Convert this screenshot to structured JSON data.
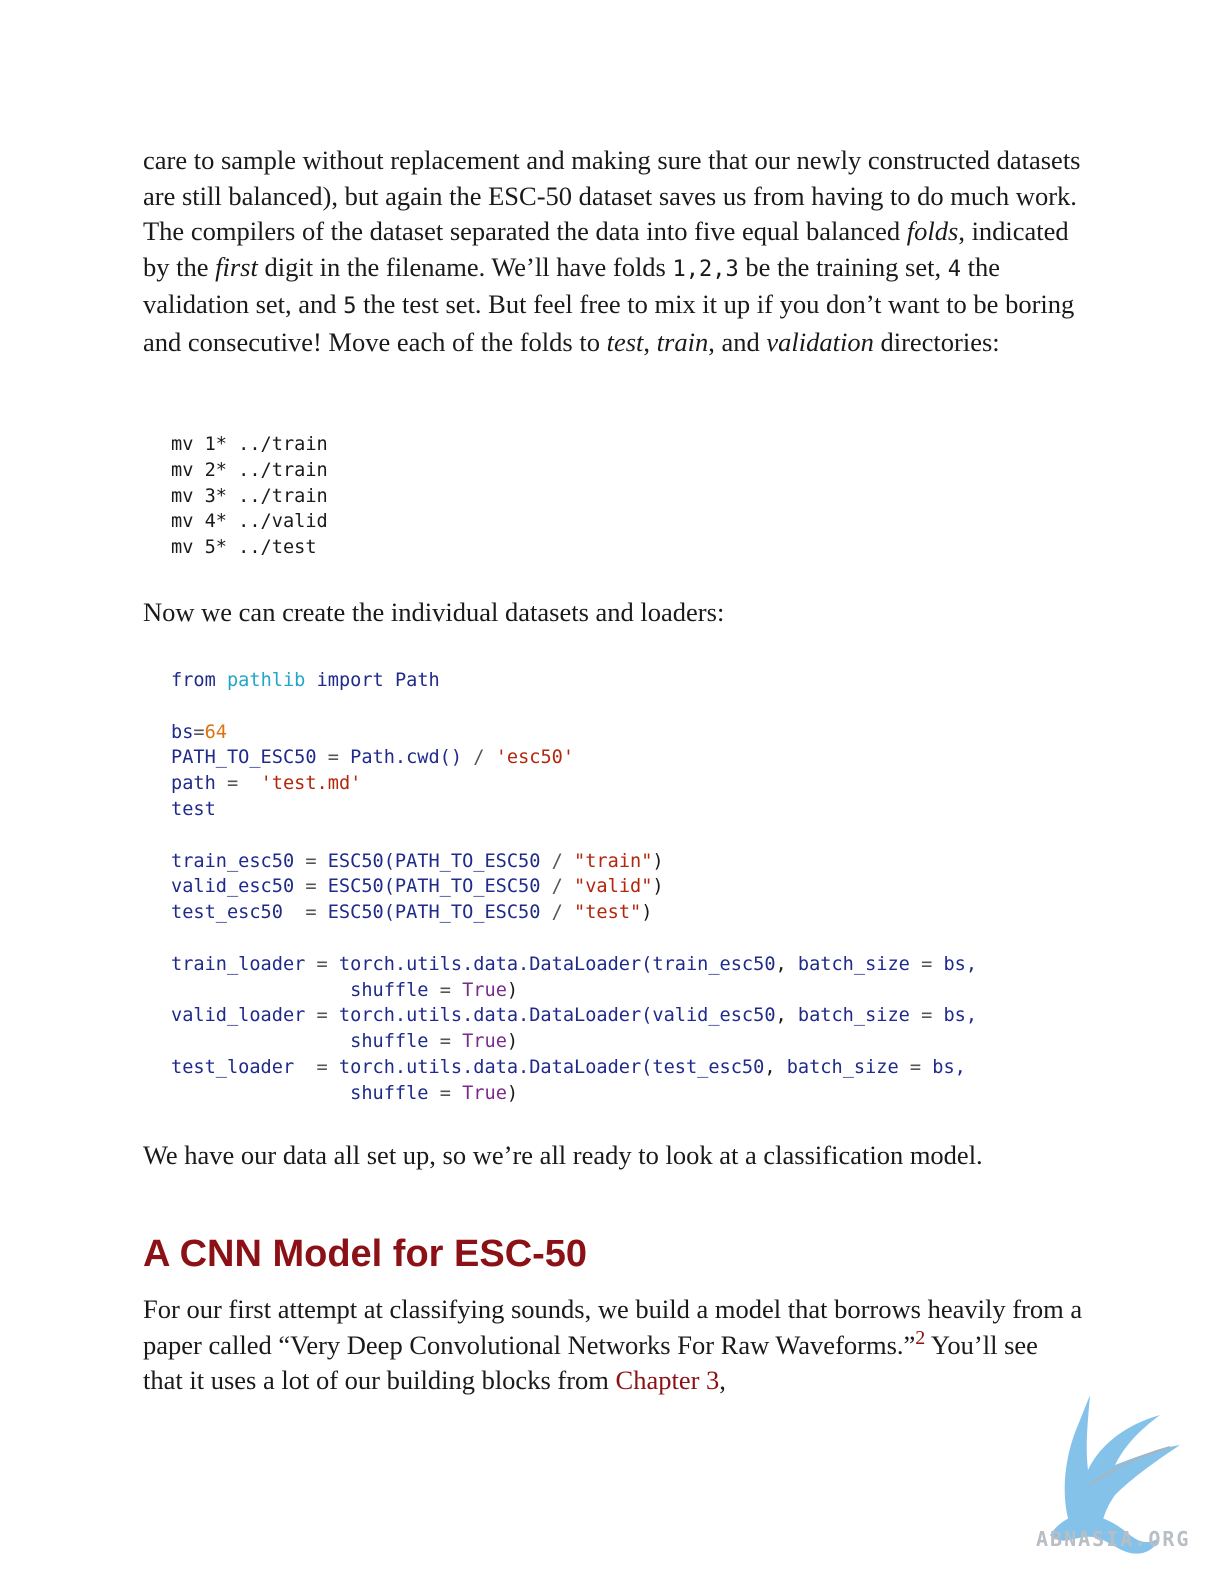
{
  "para1": {
    "t1": "care to sample without replacement and making sure that our newly constructed datasets are still balanced), but again the ESC-50 dataset saves us from having to do much work. The compilers of the dataset separated the data into five equal balanced ",
    "folds": "folds",
    "t2": ", indicated by the ",
    "first": "first",
    "t3": " digit in the filename. We’ll have folds ",
    "code1": "1,2,3",
    "t4": " be the training set, ",
    "code2": "4",
    "t5": " the validation set, and ",
    "code3": "5",
    "t6": " the test set. But feel free to mix it up if you don’t want to be boring and consecutive! Move each of the folds to ",
    "test": "test",
    "t7": ", ",
    "train": "train",
    "t8": ", and ",
    "validation": "validation",
    "t9": " directories:"
  },
  "shell_code": [
    "mv 1* ../train",
    "mv 2* ../train",
    "mv 3* ../train",
    "mv 4* ../valid",
    "mv 5* ../test"
  ],
  "para2": "Now we can create the individual datasets and loaders:",
  "py": {
    "from": "from",
    "pathlib": "pathlib",
    "import": "import",
    "Path": "Path",
    "bs": "bs",
    "eq": "=",
    "n64": "64",
    "line_path_a": "PATH_TO_ESC50 ",
    "line_path_b": " Path.cwd() ",
    "slash": "/",
    "esc50": "'esc50'",
    "path": "path ",
    "testmd": "'test.md'",
    "test": "test",
    "train_esc50": "train_esc50 ",
    "valid_esc50": "valid_esc50 ",
    "test_esc50": "test_esc50  ",
    "esc50_call": " ESC50(PATH_TO_ESC50 ",
    "s_train": "\"train\"",
    "s_valid": "\"valid\"",
    "s_test": "\"test\"",
    "train_loader": "train_loader ",
    "valid_loader": "valid_loader ",
    "test_loader": "test_loader  ",
    "dl_call": " torch.utils.data.DataLoader(",
    "batch_size": "batch_size",
    "bs_end": " bs,",
    "indent": "                ",
    "shuffle": "shuffle",
    "True": "True"
  },
  "para3": "We have our data all set up, so we’re all ready to look at a classification model.",
  "heading": "A CNN Model for ESC-50",
  "para4": {
    "t1": "For our first attempt at classifying sounds, we build a model that borrows heavily from a paper called “Very Deep Convolutional Networks For Raw Waveforms.”",
    "footnote": "2",
    "t2": " You’ll see that it uses a lot of our building blocks from ",
    "link": "Chapter 3",
    "t3": ","
  },
  "watermark": "ABNASIA.ORG",
  "colors": {
    "heading": "#8b1116",
    "link": "#8b1116",
    "logo": "#6fb8e6"
  }
}
